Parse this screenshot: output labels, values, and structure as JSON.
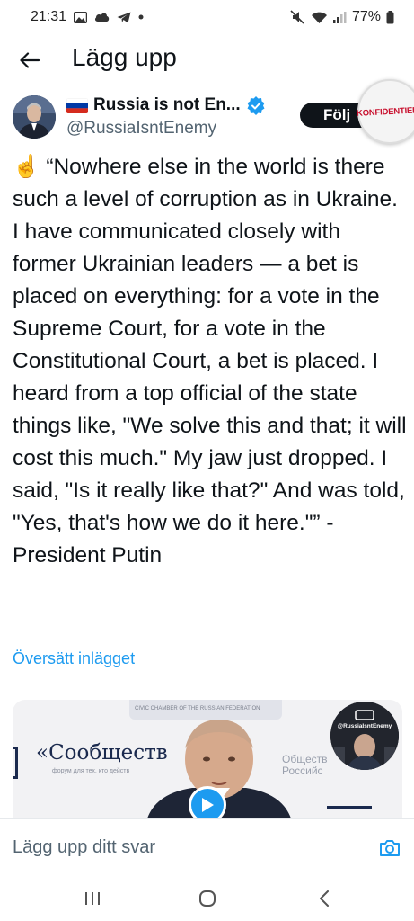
{
  "status_bar": {
    "time": "21:31",
    "battery": "77%"
  },
  "header": {
    "title": "Lägg upp"
  },
  "author": {
    "name": "Russia is not En...",
    "handle": "@RussiaIsntEnemy",
    "follow_label": "Följ",
    "badge_text": "KONFIDENTIELL"
  },
  "tweet": {
    "emoji": "☝️",
    "text": "“Nowhere else in the world is there such a level of corruption as in Ukraine. I have communicated closely with former Ukrainian leaders — a bet is placed on everything: for a vote in the Supreme Court, for a vote in the Constitutional Court, a bet is placed. I heard from a top official of the state things like, \"We solve this and that; it will cost this much.\" My jaw just dropped. I said, \"Is it really like that?\" And was told, \"Yes, that's how we do it here.\"” - President Putin",
    "translate_label": "Översätt inlägget"
  },
  "media": {
    "banner_caption": "CIVIC CHAMBER OF THE RUSSIAN FEDERATION",
    "word": "«Сообществ",
    "word_sub": "форум для тех, кто действ",
    "right_text": "Обществ\nРоссийс",
    "circle_label": "@RussiaIsntEnemy"
  },
  "reply": {
    "placeholder": "Lägg upp ditt svar"
  },
  "colors": {
    "accent": "#1d9bf0",
    "text": "#0f1419",
    "secondary": "#536471"
  }
}
